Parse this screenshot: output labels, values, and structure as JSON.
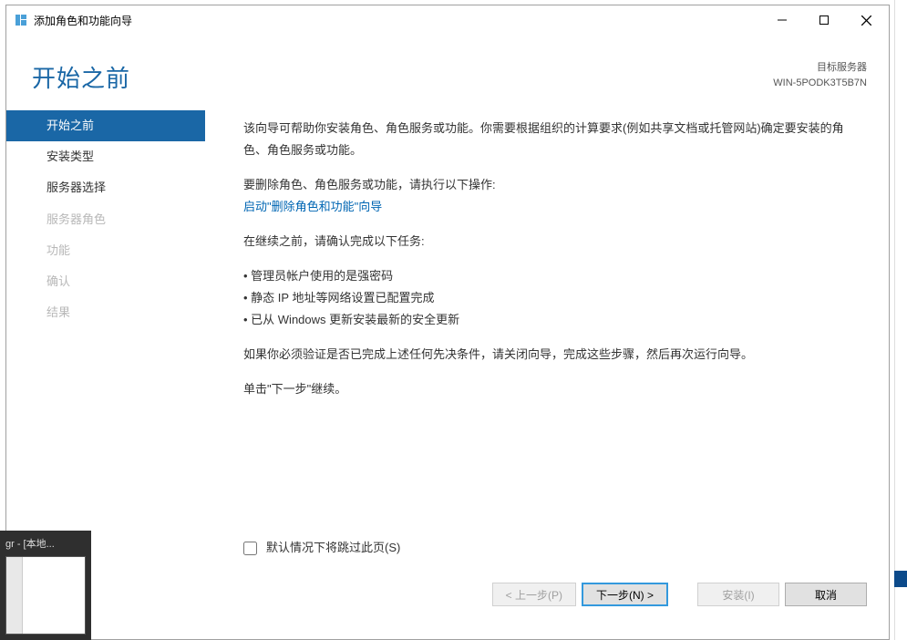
{
  "window": {
    "title": "添加角色和功能向导"
  },
  "header": {
    "page_title": "开始之前",
    "target_label": "目标服务器",
    "target_value": "WIN-5PODK3T5B7N"
  },
  "sidebar": {
    "items": [
      {
        "label": "开始之前",
        "active": true,
        "disabled": false
      },
      {
        "label": "安装类型",
        "active": false,
        "disabled": false
      },
      {
        "label": "服务器选择",
        "active": false,
        "disabled": false
      },
      {
        "label": "服务器角色",
        "active": false,
        "disabled": true
      },
      {
        "label": "功能",
        "active": false,
        "disabled": true
      },
      {
        "label": "确认",
        "active": false,
        "disabled": true
      },
      {
        "label": "结果",
        "active": false,
        "disabled": true
      }
    ]
  },
  "content": {
    "para1": "该向导可帮助你安装角色、角色服务或功能。你需要根据组织的计算要求(例如共享文档或托管网站)确定要安装的角色、角色服务或功能。",
    "para2": "要删除角色、角色服务或功能，请执行以下操作:",
    "link": "启动\"删除角色和功能\"向导",
    "para3": "在继续之前，请确认完成以下任务:",
    "bullets": [
      "管理员帐户使用的是强密码",
      "静态 IP 地址等网络设置已配置完成",
      "已从 Windows 更新安装最新的安全更新"
    ],
    "para4": "如果你必须验证是否已完成上述任何先决条件，请关闭向导，完成这些步骤，然后再次运行向导。",
    "para5": "单击\"下一步\"继续。",
    "skip_checkbox": "默认情况下将跳过此页(S)"
  },
  "footer": {
    "prev": "< 上一步(P)",
    "next": "下一步(N) >",
    "install": "安装(I)",
    "cancel": "取消"
  },
  "taskbar": {
    "thumb_title": "gr - [本地..."
  }
}
